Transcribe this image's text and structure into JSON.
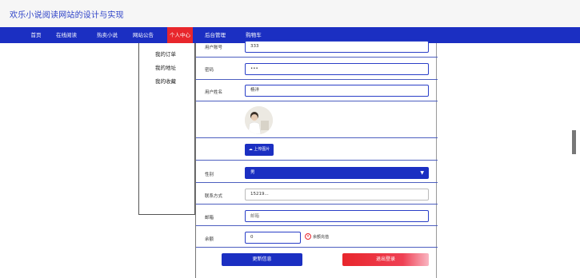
{
  "header": {
    "site_title": "欢乐小说阅读网站的设计与实现"
  },
  "nav": {
    "items": [
      {
        "label": "首页"
      },
      {
        "label": "在线阅读"
      },
      {
        "label": "热卖小说"
      },
      {
        "label": "网站公告"
      },
      {
        "label": "个人中心",
        "active": true
      },
      {
        "label": "后台管理"
      },
      {
        "label": "购物车"
      }
    ],
    "active_color": "#e8262c",
    "bar_color": "#1b2fc2"
  },
  "dropdown": {
    "items": [
      "我的订单",
      "我的地址",
      "我的收藏"
    ]
  },
  "form": {
    "account": {
      "label": "用户账号",
      "value": "333"
    },
    "password": {
      "label": "密码",
      "value": "•••"
    },
    "name": {
      "label": "用户姓名",
      "value": "杨洋"
    },
    "upload_label": "上传图片",
    "gender": {
      "label": "性别",
      "value": "男"
    },
    "phone": {
      "label": "联系方式",
      "value": "15219..."
    },
    "email": {
      "label": "邮箱",
      "placeholder": "邮箱"
    },
    "balance": {
      "label": "余额",
      "value": "0",
      "error": "余额充值"
    },
    "update_label": "更新信息",
    "logout_label": "退出登录"
  }
}
